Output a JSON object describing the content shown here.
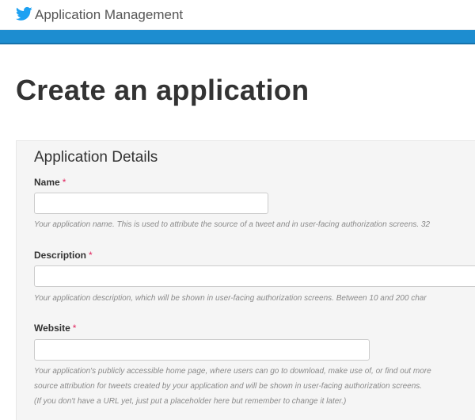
{
  "header": {
    "logo_icon": "twitter-bird-icon",
    "title": "Application Management",
    "accent_color": "#1d8dd0",
    "brand_color": "#1da1f2"
  },
  "page": {
    "title": "Create an application"
  },
  "form": {
    "section_title": "Application Details",
    "required_marker": "*",
    "name": {
      "label": "Name",
      "value": "",
      "placeholder": "",
      "help": "Your application name. This is used to attribute the source of a tweet and in user-facing authorization screens. 32"
    },
    "description": {
      "label": "Description",
      "value": "",
      "placeholder": "",
      "help": "Your application description, which will be shown in user-facing authorization screens. Between 10 and 200 char"
    },
    "website": {
      "label": "Website",
      "value": "",
      "placeholder": "",
      "help_line1": "Your application's publicly accessible home page, where users can go to download, make use of, or find out more",
      "help_line2": "source attribution for tweets created by your application and will be shown in user-facing authorization screens.",
      "help_line3": "(If you don't have a URL yet, just put a placeholder here but remember to change it later.)"
    }
  }
}
